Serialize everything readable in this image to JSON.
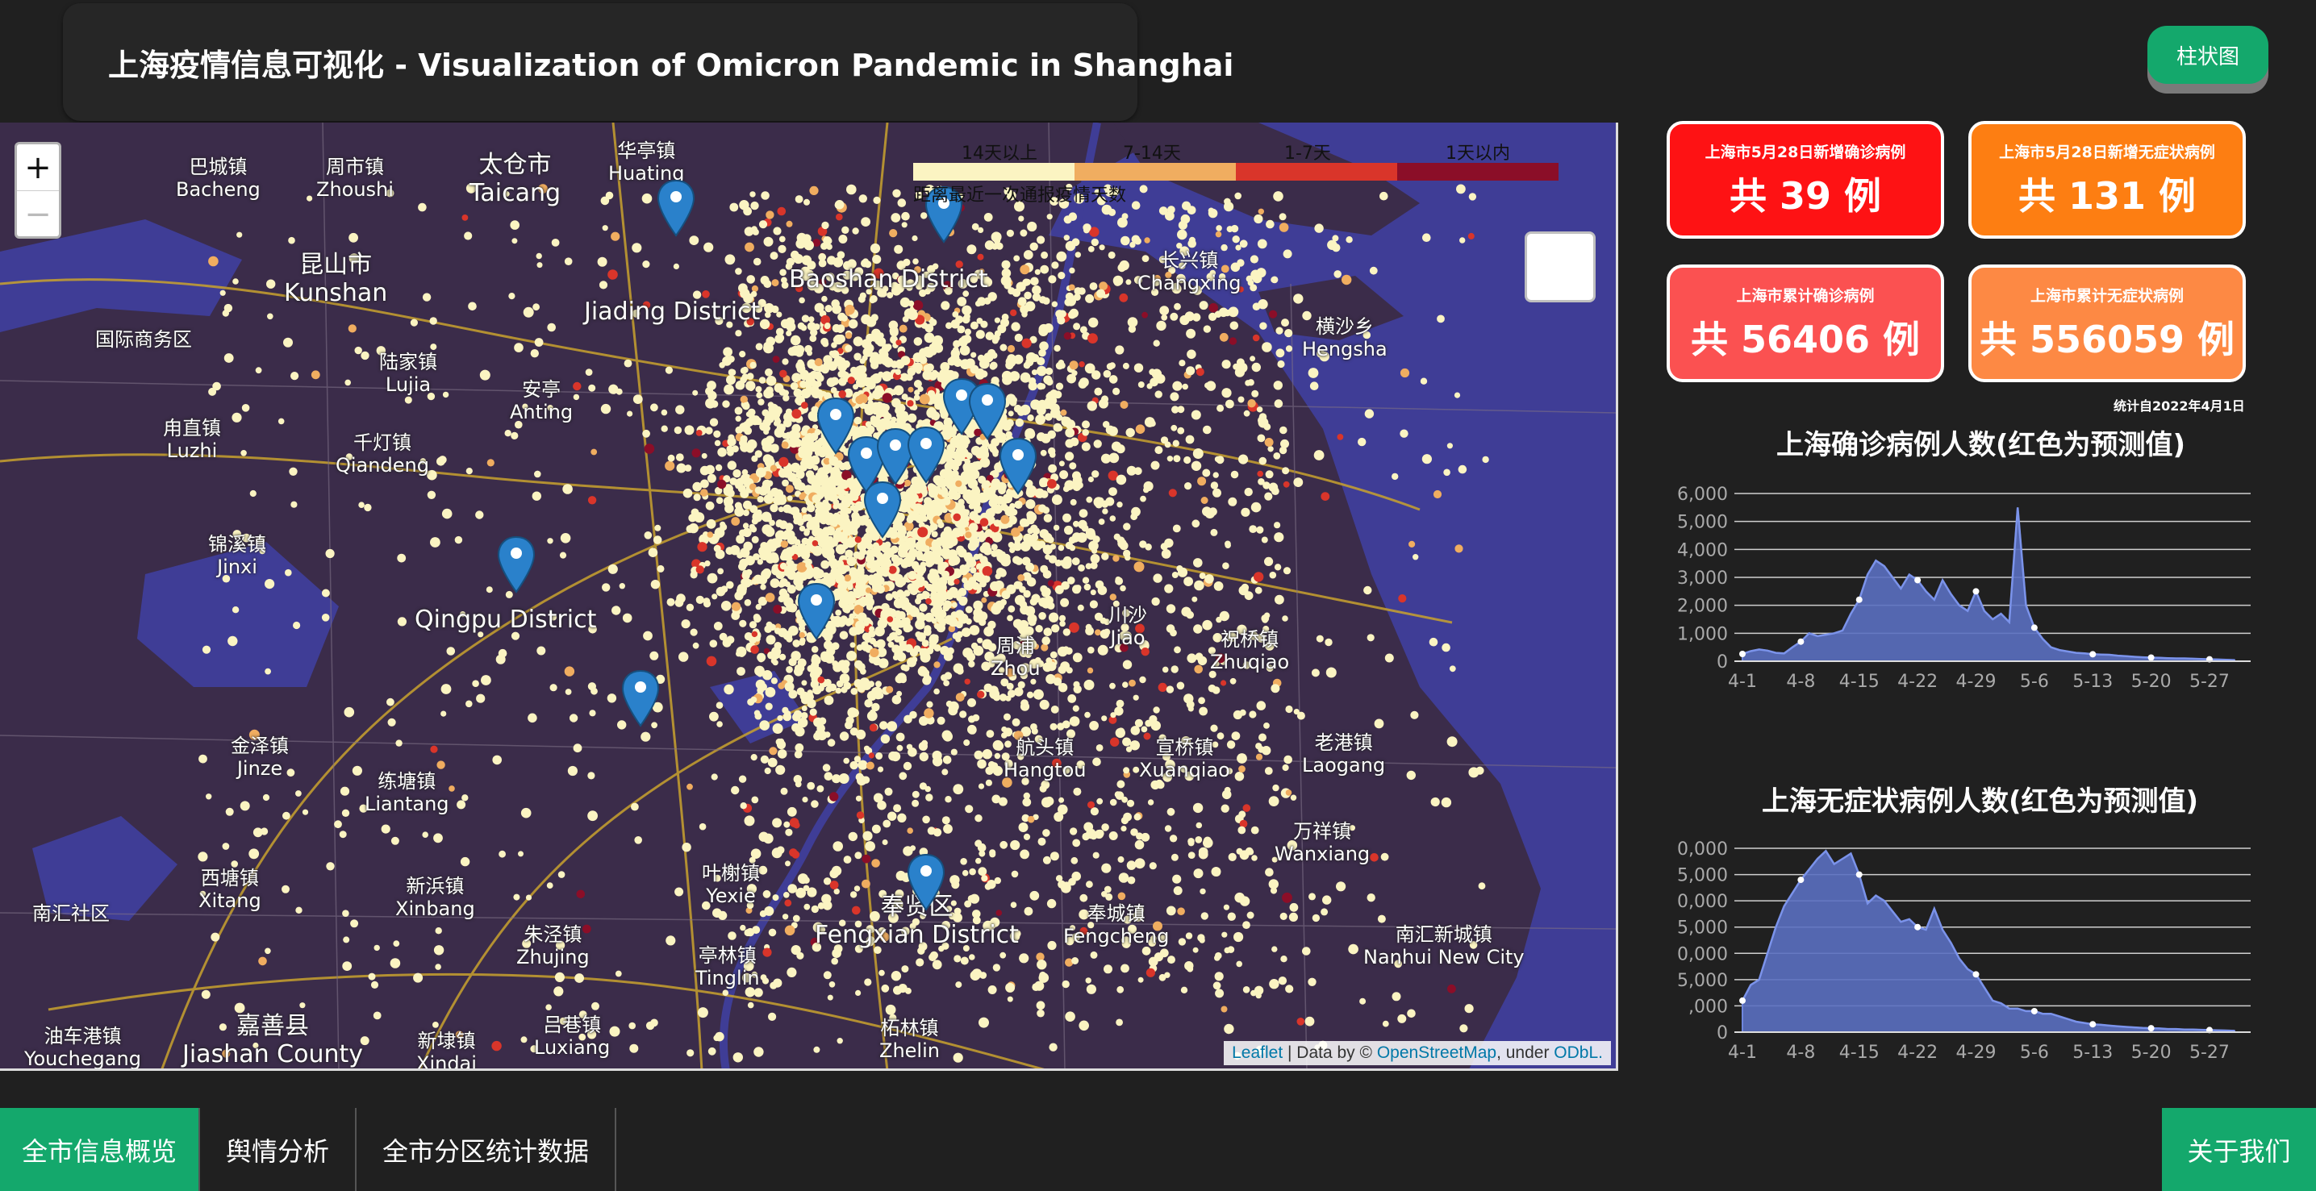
{
  "header": {
    "title": "上海疫情信息可视化 - Visualization of Omicron Pandemic in Shanghai",
    "bar_button": "柱状图"
  },
  "map": {
    "zoom_in": "+",
    "zoom_out": "−",
    "legend": {
      "labels": [
        "14天以上",
        "7-14天",
        "1-7天",
        "1天以内"
      ],
      "colors": [
        "#fbf4c2",
        "#f0ad60",
        "#d9352a",
        "#8b0e28"
      ],
      "caption": "距离最近一次通报疫情天数"
    },
    "attribution": {
      "leaflet": "Leaflet",
      "text1": " | Data by © ",
      "osm": "OpenStreetMap",
      "text2": ", under ",
      "odbl": "ODbL."
    },
    "places": [
      {
        "zh": "巴城镇",
        "en": "Bacheng"
      },
      {
        "zh": "周市镇",
        "en": "Zhoushi"
      },
      {
        "zh": "太仓市",
        "en": "Taicang"
      },
      {
        "zh": "华亭镇",
        "en": "Huating"
      },
      {
        "zh": "昆山市",
        "en": "Kunshan"
      },
      {
        "zh": "国际商务区",
        "en": ""
      },
      {
        "zh": "陆家镇",
        "en": "Lujia"
      },
      {
        "zh": "安亭",
        "en": "Anting"
      },
      {
        "zh": "甪直镇",
        "en": "Luzhi"
      },
      {
        "zh": "千灯镇",
        "en": "Qiandeng"
      },
      {
        "zh": "锦溪镇",
        "en": "Jinxi"
      },
      {
        "zh": "",
        "en": "Jiading District"
      },
      {
        "zh": "",
        "en": "Baoshan District"
      },
      {
        "zh": "长兴镇",
        "en": "Changxing"
      },
      {
        "zh": "横沙乡",
        "en": "Hengsha"
      },
      {
        "zh": "",
        "en": "Qingpu District"
      },
      {
        "zh": "金泽镇",
        "en": "Jinze"
      },
      {
        "zh": "练塘镇",
        "en": "Liantang"
      },
      {
        "zh": "西塘镇",
        "en": "Xitang"
      },
      {
        "zh": "新浜镇",
        "en": "Xinbang"
      },
      {
        "zh": "南汇社区",
        "en": ""
      },
      {
        "zh": "叶榭镇",
        "en": "Yexie"
      },
      {
        "zh": "朱泾镇",
        "en": "Zhujing"
      },
      {
        "zh": "亭林镇",
        "en": "Tinglin"
      },
      {
        "zh": "奉贤区",
        "en": "Fengxian District"
      },
      {
        "zh": "奉城镇",
        "en": "Fengcheng"
      },
      {
        "zh": "南汇新城镇",
        "en": "Nanhui New City"
      },
      {
        "zh": "嘉善县",
        "en": "Jiashan County"
      },
      {
        "zh": "吕巷镇",
        "en": "Luxiang"
      },
      {
        "zh": "柘林镇",
        "en": "Zhelin"
      },
      {
        "zh": "新埭镇",
        "en": "Xindai"
      },
      {
        "zh": "油车港镇",
        "en": "Youchegang"
      },
      {
        "zh": "航头镇",
        "en": "Hangtou"
      },
      {
        "zh": "宣桥镇",
        "en": "Xuanqiao"
      },
      {
        "zh": "老港镇",
        "en": "Laogang"
      },
      {
        "zh": "万祥镇",
        "en": "Wanxiang"
      },
      {
        "zh": "祝桥镇",
        "en": "Zhuqiao"
      },
      {
        "zh": "川沙",
        "en": "Jiao"
      },
      {
        "zh": "周浦",
        "en": "Zhou"
      }
    ]
  },
  "stats": [
    {
      "label": "上海市5月28日新增确诊病例",
      "value": "共 39 例",
      "color": "#fe1214"
    },
    {
      "label": "上海市5月28日新增无症状病例",
      "value": "共 131 例",
      "color": "#fd7e12"
    },
    {
      "label": "上海市累计确诊病例",
      "value": "共 56406 例",
      "color": "#fb5151"
    },
    {
      "label": "上海市累计无症状病例",
      "value": "共 556059 例",
      "color": "#fd8944"
    }
  ],
  "since_note": "统计自2022年4月1日",
  "chart_data": [
    {
      "type": "area",
      "title": "上海确诊病例人数(红色为预测值)",
      "x_ticks": [
        "4-1",
        "4-8",
        "4-15",
        "4-22",
        "4-29",
        "5-6",
        "5-13",
        "5-20",
        "5-27"
      ],
      "y_ticks": [
        "0",
        "1,000",
        "2,000",
        "3,000",
        "4,000",
        "5,000",
        "6,000"
      ],
      "ylim": [
        0,
        6000
      ],
      "days": 60,
      "values": [
        260,
        360,
        420,
        380,
        300,
        280,
        500,
        700,
        1000,
        900,
        950,
        1000,
        1100,
        1700,
        2200,
        3100,
        3600,
        3400,
        3000,
        2600,
        3100,
        2900,
        2500,
        2200,
        2900,
        2400,
        2000,
        1800,
        2500,
        1800,
        1500,
        1700,
        1400,
        5500,
        2000,
        1200,
        800,
        500,
        400,
        350,
        300,
        280,
        250,
        240,
        230,
        200,
        180,
        160,
        140,
        130,
        120,
        110,
        100,
        100,
        90,
        80,
        70,
        60,
        50,
        40
      ]
    },
    {
      "type": "area",
      "title": "上海无症状病例人数(红色为预测值)",
      "x_ticks": [
        "4-1",
        "4-8",
        "4-15",
        "4-22",
        "4-29",
        "5-6",
        "5-13",
        "5-20",
        "5-27"
      ],
      "y_ticks": [
        "0",
        ",000",
        "5,000",
        "0,000",
        "5,000",
        "0,000",
        "5,000",
        "0,000"
      ],
      "ylim": [
        0,
        7
      ],
      "days": 60,
      "values": [
        1.2,
        1.8,
        2.0,
        3.0,
        4.0,
        4.8,
        5.3,
        5.8,
        6.2,
        6.6,
        6.9,
        6.4,
        6.6,
        6.8,
        6.0,
        4.9,
        5.2,
        5.0,
        4.6,
        4.2,
        4.3,
        4.0,
        3.9,
        4.7,
        3.9,
        3.4,
        2.8,
        2.4,
        2.2,
        1.7,
        1.2,
        1.1,
        0.9,
        0.9,
        0.8,
        0.8,
        0.7,
        0.7,
        0.6,
        0.5,
        0.4,
        0.35,
        0.3,
        0.28,
        0.25,
        0.22,
        0.2,
        0.18,
        0.16,
        0.15,
        0.14,
        0.12,
        0.12,
        0.1,
        0.1,
        0.09,
        0.08,
        0.07,
        0.06,
        0.05
      ]
    }
  ],
  "nav": {
    "tabs": [
      "全市信息概览",
      "舆情分析",
      "全市分区统计数据"
    ],
    "about": "关于我们"
  }
}
